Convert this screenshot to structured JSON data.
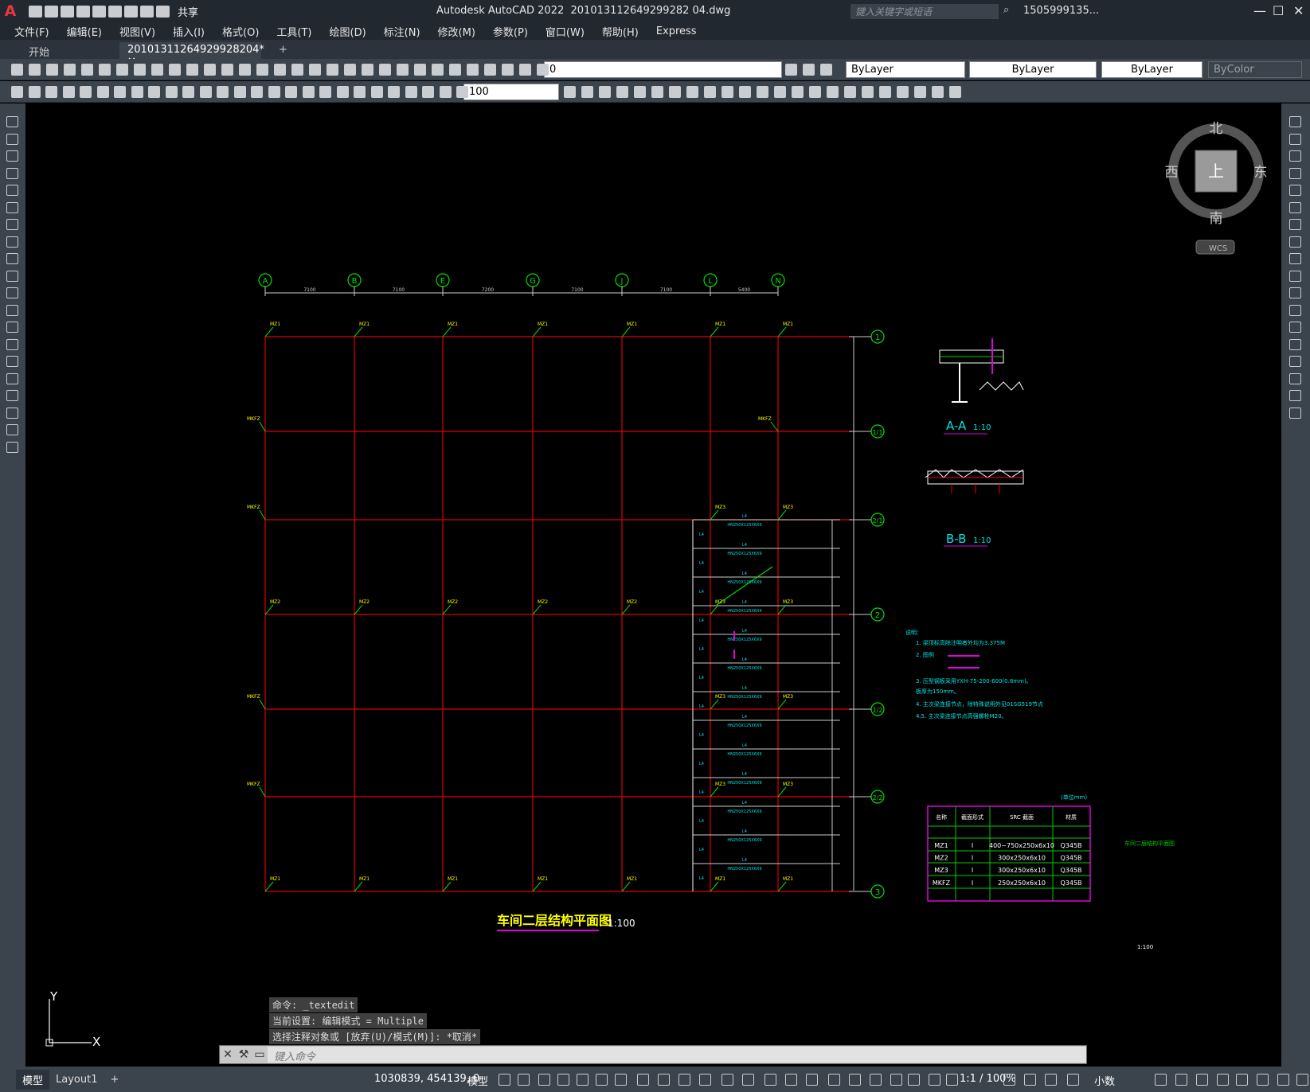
{
  "app": {
    "logo": "A",
    "share": "共享",
    "title": "Autodesk AutoCAD 2022",
    "filename": "201013112649299282 04.dwg",
    "search_placeholder": "键入关键字或短语",
    "user": "1505999135...",
    "menu": [
      "文件(F)",
      "编辑(E)",
      "视图(V)",
      "插入(I)",
      "格式(O)",
      "工具(T)",
      "绘图(D)",
      "标注(N)",
      "修改(M)",
      "参数(P)",
      "窗口(W)",
      "帮助(H)",
      "Express"
    ]
  },
  "tabs": {
    "start": "开始",
    "doc": "20101311264929928204*",
    "close": "✕",
    "add": "+"
  },
  "props": {
    "layer": "0",
    "color": "ByLayer",
    "linetype": "ByLayer",
    "lineweight": "ByLayer",
    "plotstyle": "ByColor",
    "dimscale": "100"
  },
  "viewcube": {
    "north": "北",
    "south": "南",
    "east": "东",
    "west": "西",
    "top": "上",
    "wcs": "WCS"
  },
  "drawing": {
    "axes_h": [
      "A",
      "B",
      "E",
      "G",
      "J",
      "L",
      "N"
    ],
    "axes_v": [
      "1",
      "1/1",
      "2/1",
      "2",
      "1/2",
      "2/2",
      "3"
    ],
    "spans": [
      "7100",
      "7100",
      "7200",
      "7100",
      "7100",
      "5400"
    ],
    "col_tags_top": [
      "MZ1",
      "MZ1",
      "MZ1",
      "MZ1",
      "MZ1",
      "MZ1",
      "MZ1"
    ],
    "col_tags_mid": [
      "MZ2",
      "MZ2",
      "MZ2",
      "MZ2",
      "MZ2"
    ],
    "col_tag_mkfz": "MKFZ",
    "col_tag_mz3": "MZ3",
    "beam_label": "L4",
    "beam_spec": "HN250X125X6X9",
    "title": "车间二层结构平面图",
    "scale": "1:100",
    "section_aa": "A-A",
    "section_bb": "B-B",
    "section_scale": "1:10",
    "notes_title": "说明：",
    "notes": [
      "1. 梁顶标高除注明者外均为3.375M",
      "2. 图例",
      "3. 压型钢板采用YXH-75-200-600(0.8mm)。",
      "   板厚为150mm。",
      "4. 主次梁连接节点，除特殊说明外见01SG519节点",
      "   4.5. 主次梁连接节点高强螺栓M20。"
    ],
    "table_unit": "(单位mm)",
    "table_headers": [
      "名称",
      "截面形式",
      "SRC 截面",
      "材质"
    ],
    "table_rows": [
      [
        "MZ1",
        "I",
        "400~750x250x6x10",
        "Q345B"
      ],
      [
        "MZ2",
        "I",
        "300x250x6x10",
        "Q345B"
      ],
      [
        "MZ3",
        "I",
        "300x250x6x10",
        "Q345B"
      ],
      [
        "MKFZ",
        "I",
        "250x250x6x10",
        "Q345B"
      ]
    ],
    "side_text": [
      "车间二层结构平面图",
      "1:100"
    ]
  },
  "command": {
    "history": [
      "命令: _textedit",
      "当前设置: 编辑模式 = Multiple",
      "选择注释对象或 [放弃(U)/模式(M)]: *取消*"
    ],
    "placeholder": "键入命令"
  },
  "status": {
    "tab_model": "模型",
    "tab_layout": "Layout1",
    "add": "+",
    "coords": "1030839, 454139, 0",
    "model": "模型",
    "scale": "1:1 / 100%",
    "units": "小数"
  },
  "ucs": {
    "x": "X",
    "y": "Y"
  },
  "colors": {
    "grid": "#e00000",
    "axis_bubble": "#00e000",
    "cyan": "#00e5e5",
    "magenta": "#e000e0",
    "yellow": "#ffff00",
    "white": "#ffffff"
  }
}
